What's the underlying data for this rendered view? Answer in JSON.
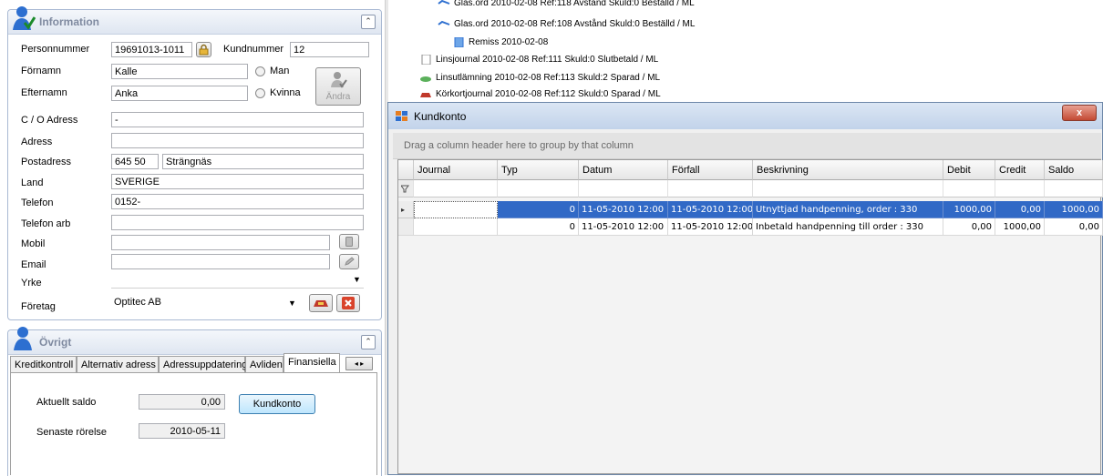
{
  "info": {
    "title": "Information",
    "labels": {
      "personnummer": "Personnummer",
      "kundnummer": "Kundnummer",
      "fornamn": "Förnamn",
      "efternamn": "Efternamn",
      "co_adress": "C / O Adress",
      "adress": "Adress",
      "postadress": "Postadress",
      "land": "Land",
      "telefon": "Telefon",
      "telefon_arb": "Telefon arb",
      "mobil": "Mobil",
      "email": "Email",
      "yrke": "Yrke",
      "foretag": "Företag",
      "man": "Man",
      "kvinna": "Kvinna",
      "andra": "Ändra"
    },
    "values": {
      "personnummer": "19691013-1011",
      "kundnummer": "12",
      "fornamn": "Kalle",
      "efternamn": "Anka",
      "co_adress": "-",
      "adress": "",
      "postnummer": "645 50",
      "ort": "Strängnäs",
      "land": "SVERIGE",
      "telefon": "0152-",
      "telefon_arb": "",
      "mobil": "",
      "email": "",
      "yrke": "",
      "foretag": "Optitec AB"
    }
  },
  "ovrigt": {
    "title": "Övrigt",
    "tabs": [
      "Kreditkontroll",
      "Alternativ adress",
      "Adressuppdatering",
      "Avliden",
      "Finansiella"
    ],
    "active_tab": "Finansiella",
    "aktuellt_saldo_label": "Aktuellt saldo",
    "aktuellt_saldo": "0,00",
    "kundkonto_button": "Kundkonto",
    "senaste_rorelse_label": "Senaste rörelse",
    "senaste_rorelse": "2010-05-11"
  },
  "tree": [
    "Glas.ord  2010-02-08 Ref:118 Avstånd Skuld:0 Beställd / ML",
    "Glas.ord  2010-02-08 Ref:108 Avstånd Skuld:0 Beställd / ML",
    "Remiss  2010-02-08",
    "Linsjournal  2010-02-08 Ref:111 Skuld:0 Slutbetald / ML",
    "Linsutlämning  2010-02-08 Ref:113 Skuld:2 Sparad / ML",
    "Körkortjournal  2010-02-08 Ref:112 Skuld:0 Sparad / ML"
  ],
  "dialog": {
    "title": "Kundkonto",
    "close": "x",
    "group_hint": "Drag a column header here to group by that column",
    "columns": [
      "Journal",
      "Typ",
      "Datum",
      "Förfall",
      "Beskrivning",
      "Debit",
      "Credit",
      "Saldo"
    ],
    "rows": [
      {
        "journal": "",
        "typ": "0",
        "datum": "11-05-2010 12:00",
        "forfall": "11-05-2010 12:00",
        "beskrivning": "Utnyttjad handpenning, order : 330",
        "debit": "1000,00",
        "credit": "0,00",
        "saldo": "1000,00"
      },
      {
        "journal": "",
        "typ": "0",
        "datum": "11-05-2010 12:00",
        "forfall": "11-05-2010 12:00",
        "beskrivning": "Inbetald handpenning till order : 330",
        "debit": "0,00",
        "credit": "1000,00",
        "saldo": "0,00"
      }
    ]
  },
  "colors": {
    "selection": "#3169c6",
    "groupbox_border": "#a9b9d3",
    "delete_red": "#d9432b"
  }
}
